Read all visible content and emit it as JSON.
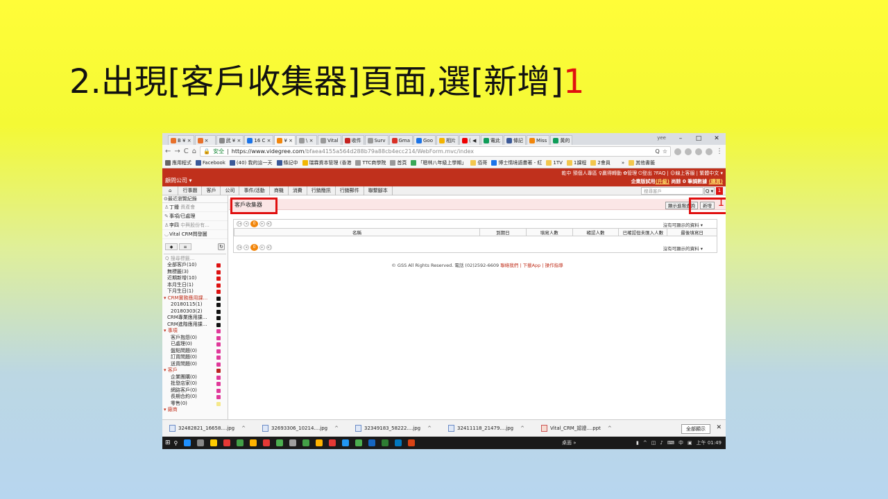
{
  "slide": {
    "title": "2.出現[客戶收集器]頁面,選[新增]",
    "step_number": "1"
  },
  "browser": {
    "tabs": [
      {
        "label": "B ¥ ×",
        "color": "#e8712b"
      },
      {
        "label": "×",
        "color": "#e8712b"
      },
      {
        "label": "武 ¥ ×",
        "color": "#888"
      },
      {
        "label": "16 C ×",
        "color": "#1a73e8"
      },
      {
        "label": "¥ ×",
        "color": "#f2860b",
        "active": true
      },
      {
        "label": "\\ ×",
        "color": "#999"
      },
      {
        "label": "Vital",
        "color": "#999"
      },
      {
        "label": "收件",
        "color": "#c5221f"
      },
      {
        "label": "Surv",
        "color": "#999"
      },
      {
        "label": "Gma",
        "color": "#d93025"
      },
      {
        "label": "Goo",
        "color": "#1a73e8"
      },
      {
        "label": "相片",
        "color": "#f4b400"
      },
      {
        "label": "( ◀",
        "color": "#e00"
      },
      {
        "label": "電此",
        "color": "#0f9d58"
      },
      {
        "label": "條記",
        "color": "#3b5998"
      },
      {
        "label": "Miss",
        "color": "#f2860b"
      },
      {
        "label": "黃的",
        "color": "#0f9d58"
      }
    ],
    "user": "yee",
    "win_min": "–",
    "win_max": "□",
    "win_close": "✕",
    "secure_label": "安全",
    "url_host": "https://www.videgree.com",
    "url_path": "/bfaea4155a564d288b79a88cb4ecc214/WebForm.mvc/index",
    "bookmarks": [
      {
        "label": "應用程式",
        "color": "#666"
      },
      {
        "label": "Facebook",
        "color": "#3b5998"
      },
      {
        "label": "(40) 我的這一天",
        "color": "#3b5998"
      },
      {
        "label": "條記中",
        "color": "#3b5998"
      },
      {
        "label": "瑞霖資本管理 (香港",
        "color": "#f2b705"
      },
      {
        "label": "TTC商學院",
        "color": "#999"
      },
      {
        "label": "首頁",
        "color": "#999"
      },
      {
        "label": "「聰林八年級上學期」",
        "color": "#3aa757"
      },
      {
        "label": "佰哥",
        "color": "#f2c74e"
      },
      {
        "label": "博士情境語畫著 - 紅",
        "color": "#1a73e8"
      },
      {
        "label": "1TV",
        "color": "#f2c74e"
      },
      {
        "label": "1課程",
        "color": "#f2c74e"
      },
      {
        "label": "2會員",
        "color": "#f2c74e"
      },
      {
        "label": "»",
        "color": "transparent"
      },
      {
        "label": "其他書籤",
        "color": "#f2c74e"
      }
    ]
  },
  "app": {
    "company": "顧問公司 ▾",
    "top_links": "乾中 預個人專區 ♀贏得轉動 ✿管理 ⏻登出 ?FAQ | ☺線上客服 | 繁體中文 ▾",
    "trial_prefix": "企業版試用",
    "trial_upgrade": "(升級)",
    "trial_suffix": "尚餘 0 筆調數據",
    "trial_link": "(購買)",
    "menu": [
      "行事曆",
      "客戶",
      "公司",
      "事件/活動",
      "商機",
      "消費",
      "行銷簡訊",
      "行銷郵件",
      "聯繫腳本"
    ],
    "search_placeholder": "搜尋客戶",
    "search_btn": "Q ▾",
    "badge": "1"
  },
  "sidebar": {
    "header": "⊙最近瀏覽紀錄",
    "recent": [
      {
        "icon": "♙",
        "main": "丁鍾",
        "sub": "資產會"
      },
      {
        "icon": "✎",
        "main": "事項/已處理",
        "sub": ""
      },
      {
        "icon": "♙",
        "main": "李四",
        "sub": "中興股份有..."
      },
      {
        "icon": "◡",
        "main": "Vital CRM問發圖",
        "sub": ""
      }
    ],
    "tool_a": "◆",
    "tool_b": "≡",
    "refresh": "↻",
    "tag_search": "Q 搜尋標籤...",
    "items": [
      {
        "label": "全部客戶(10)",
        "indent": 1,
        "color": "#d11"
      },
      {
        "label": "無標籤(3)",
        "indent": 1,
        "color": "#d11"
      },
      {
        "label": "近期新增(10)",
        "indent": 1,
        "color": "#d11"
      },
      {
        "label": "本月生日(1)",
        "indent": 1,
        "color": "#d11"
      },
      {
        "label": "下月生日(1)",
        "indent": 1,
        "color": "#d11"
      },
      {
        "label": "▾ CRM實務應用課...",
        "indent": 0,
        "color": "#111",
        "cat": true
      },
      {
        "label": "20180115(1)",
        "indent": 2,
        "color": "#111"
      },
      {
        "label": "20180303(2)",
        "indent": 2,
        "color": "#111"
      },
      {
        "label": "CRM專業應用課...",
        "indent": 1,
        "color": "#111"
      },
      {
        "label": "CRM進階應用課...",
        "indent": 1,
        "color": "#111"
      },
      {
        "label": "▾ 事項",
        "indent": 0,
        "color": "#e0389a",
        "cat": true
      },
      {
        "label": "客戶抱怨(0)",
        "indent": 2,
        "color": "#e0389a"
      },
      {
        "label": "已處理(0)",
        "indent": 2,
        "color": "#e0389a"
      },
      {
        "label": "盤點問題(0)",
        "indent": 2,
        "color": "#e0389a"
      },
      {
        "label": "訂貨問題(0)",
        "indent": 2,
        "color": "#e0389a"
      },
      {
        "label": "送貨問題(0)",
        "indent": 2,
        "color": "#e0389a"
      },
      {
        "label": "▾ 客戶",
        "indent": 0,
        "color": "#b22",
        "cat": true
      },
      {
        "label": "企業團購(0)",
        "indent": 2,
        "color": "#e0389a"
      },
      {
        "label": "批發店家(0)",
        "indent": 2,
        "color": "#e0389a"
      },
      {
        "label": "網路客戶(0)",
        "indent": 2,
        "color": "#e0389a"
      },
      {
        "label": "長期合約(0)",
        "indent": 2,
        "color": "#e0389a"
      },
      {
        "label": "零售(0)",
        "indent": 2,
        "color": "#f5e88a"
      },
      {
        "label": "▾ 廠商",
        "indent": 0,
        "color": "transparent",
        "cat": true
      }
    ]
  },
  "main": {
    "page_title": "客戶收集器",
    "adv_search_btn": "顯示進階查詢",
    "new_btn": "新增",
    "pager_page": "0",
    "no_data": "沒有可顯示的資料 ▾",
    "columns": [
      "名稱",
      "到期日",
      "填寫人數",
      "確認人數",
      "已確認但未匯入人數",
      "最後填寫日"
    ],
    "footer_copy": "© GSS All Rights Reserved. 電話 (02)2592-6609",
    "footer_links": "聯絡我們 | 下載App | 操作指導"
  },
  "downloads": {
    "files": [
      {
        "name": "32482821_16658....jpg",
        "type": "jpg"
      },
      {
        "name": "32693306_10214....jpg",
        "type": "jpg"
      },
      {
        "name": "32349183_58222....jpg",
        "type": "jpg"
      },
      {
        "name": "32411118_21479....jpg",
        "type": "jpg"
      },
      {
        "name": "Vital_CRM_認證....ppt",
        "type": "ppt"
      }
    ],
    "chevron": "^",
    "show_all": "全部顯示",
    "close": "✕"
  },
  "taskbar": {
    "icons": [
      "#1e90ff",
      "#888",
      "#ffcc00",
      "#e53935",
      "#43a047",
      "#ffb300",
      "#e53935",
      "#4caf50",
      "#9e9e9e",
      "#43a047",
      "#ffb300",
      "#e53935",
      "#2196f3",
      "#4caf50",
      "#1565c0",
      "#2e7d32",
      "#0277bd",
      "#d84315"
    ],
    "desktop": "桌面 »",
    "ime": "中",
    "clock": "上午 01:49"
  }
}
